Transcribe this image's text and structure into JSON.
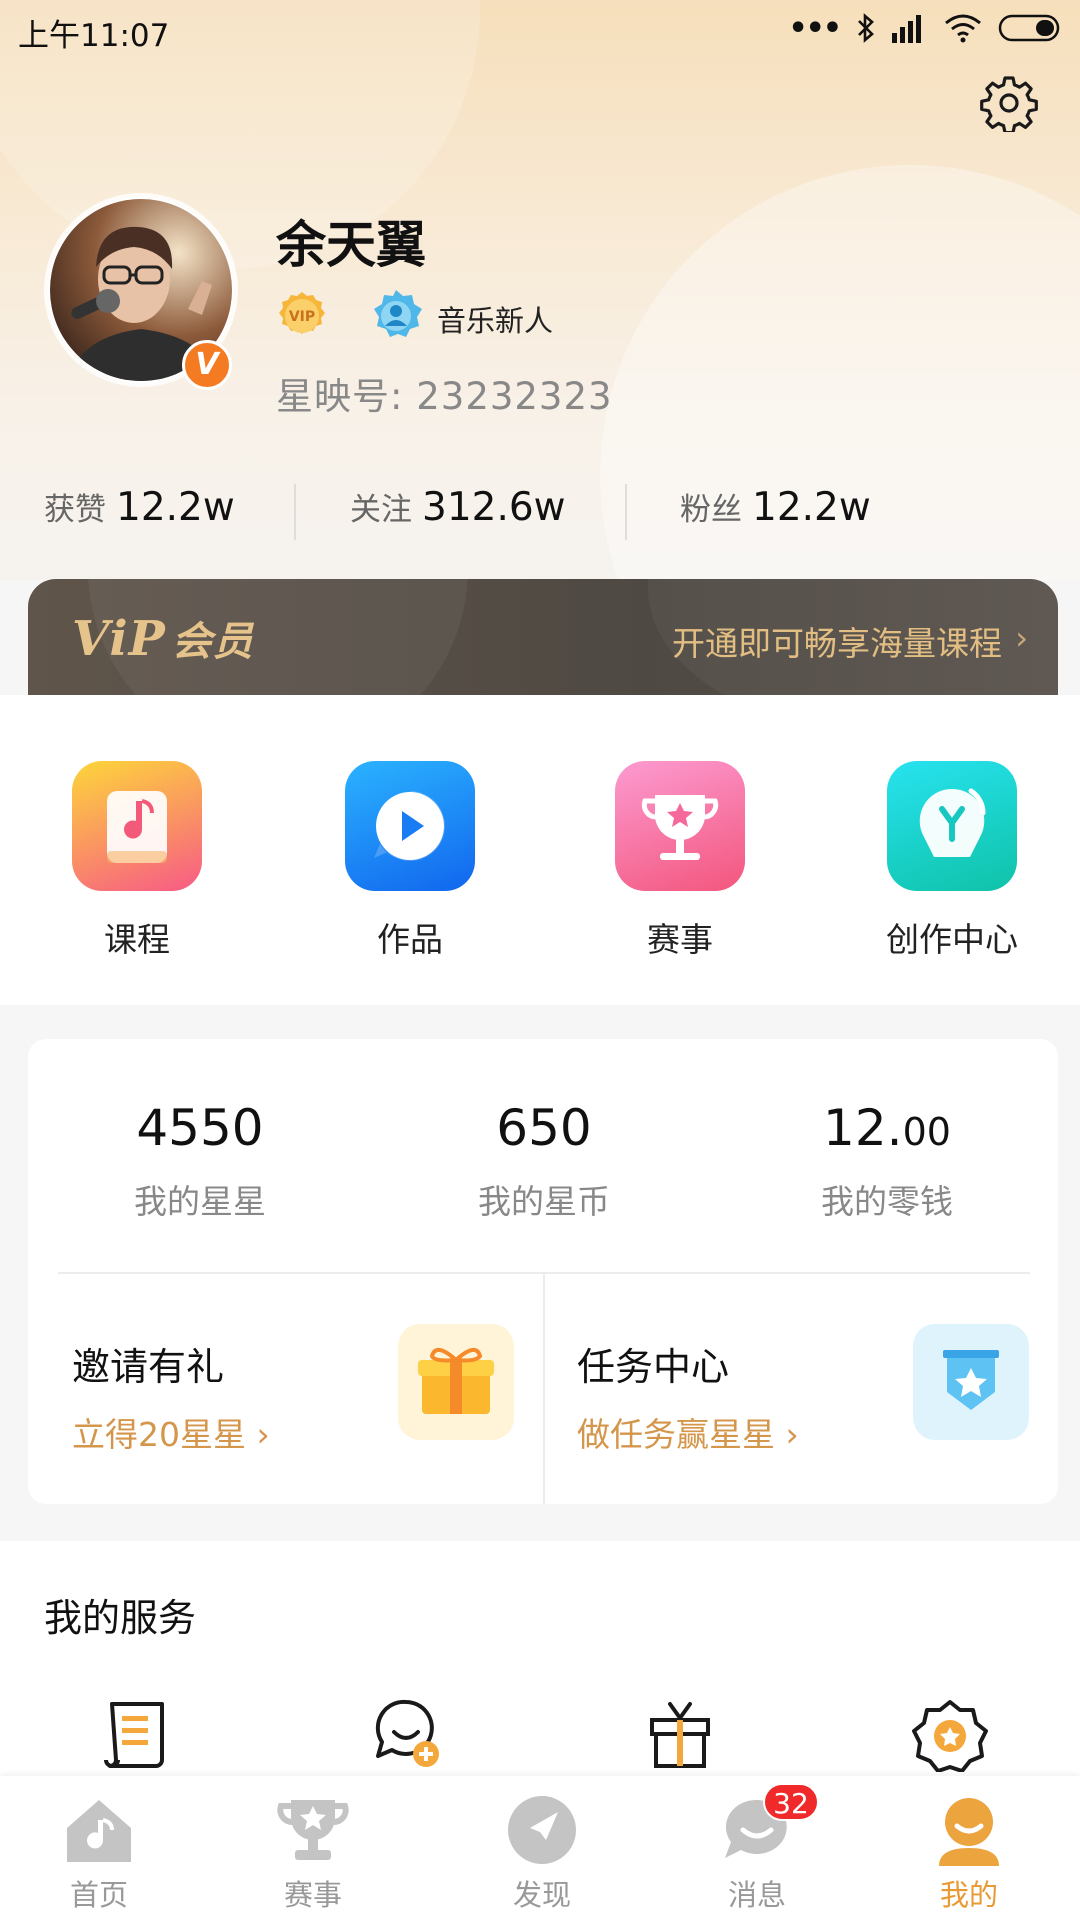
{
  "status_bar": {
    "time": "上午11:07",
    "dots": "•••"
  },
  "profile": {
    "name": "余天翼",
    "verified_mark": "V",
    "vip_badge_text": "VIP",
    "level_title": "音乐新人",
    "uid_label": "星映号:",
    "uid_value": "23232323"
  },
  "stats": [
    {
      "label": "获赞",
      "value": "12.2w"
    },
    {
      "label": "关注",
      "value": "312.6w"
    },
    {
      "label": "粉丝",
      "value": "12.2w"
    }
  ],
  "vip_banner": {
    "logo": "ViP",
    "logo_sub": "会员",
    "tip": "开通即可畅享海量课程",
    "arrow": "›"
  },
  "quick_actions": [
    {
      "label": "课程",
      "icon": "music-note-icon",
      "colors": [
        "#fdd63a",
        "#f75a86"
      ]
    },
    {
      "label": "作品",
      "icon": "play-icon",
      "colors": [
        "#2bb3ff",
        "#1166ee"
      ]
    },
    {
      "label": "赛事",
      "icon": "trophy-icon",
      "colors": [
        "#fc9bd1",
        "#f3567d"
      ]
    },
    {
      "label": "创作中心",
      "icon": "creation-icon",
      "colors": [
        "#27e3f0",
        "#0fc2a8"
      ]
    }
  ],
  "wallet": [
    {
      "value": "4550",
      "decimals": "",
      "label": "我的星星"
    },
    {
      "value": "650",
      "decimals": "",
      "label": "我的星币"
    },
    {
      "value": "12.",
      "decimals": "00",
      "label": "我的零钱"
    }
  ],
  "promos": {
    "invite": {
      "title": "邀请有礼",
      "subtitle": "立得20星星",
      "arrow": "›",
      "icon": "gift-icon"
    },
    "task": {
      "title": "任务中心",
      "subtitle": "做任务赢星星",
      "arrow": "›",
      "icon": "badge-star-icon"
    }
  },
  "services": {
    "title": "我的服务",
    "icons": [
      "scroll-list-icon",
      "chat-add-icon",
      "gift-box-icon",
      "star-badge-icon"
    ]
  },
  "tabs": [
    {
      "label": "首页",
      "icon": "home-icon",
      "active": false
    },
    {
      "label": "赛事",
      "icon": "trophy-icon",
      "active": false
    },
    {
      "label": "发现",
      "icon": "compass-icon",
      "active": false
    },
    {
      "label": "消息",
      "icon": "message-icon",
      "active": false,
      "badge": "32"
    },
    {
      "label": "我的",
      "icon": "profile-icon",
      "active": true
    }
  ],
  "colors": {
    "accent": "#e89a35",
    "promo_text": "#d4964b",
    "badge": "#f02a2a"
  }
}
